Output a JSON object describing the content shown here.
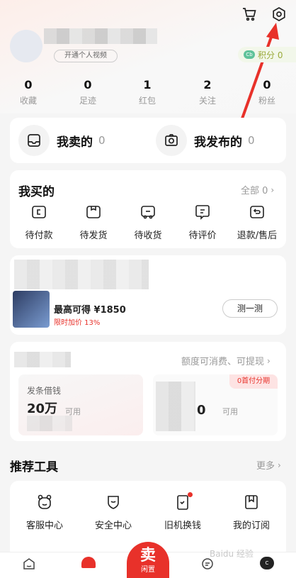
{
  "header": {
    "points_label": "积分 0",
    "points_badge": "Cb",
    "user_tag": "开通个人视频"
  },
  "stats": [
    {
      "value": "0",
      "label": "收藏"
    },
    {
      "value": "0",
      "label": "足迹"
    },
    {
      "value": "1",
      "label": "红包"
    },
    {
      "value": "2",
      "label": "关注"
    },
    {
      "value": "0",
      "label": "粉丝"
    }
  ],
  "sell": {
    "sold_label": "我卖的",
    "sold_count": "0",
    "posted_label": "我发布的",
    "posted_count": "0"
  },
  "orders": {
    "title": "我买的",
    "all_label": "全部 0",
    "items": [
      {
        "label": "待付款",
        "icon": "wallet-icon"
      },
      {
        "label": "待发货",
        "icon": "box-icon"
      },
      {
        "label": "待收货",
        "icon": "truck-icon"
      },
      {
        "label": "待评价",
        "icon": "comment-icon"
      },
      {
        "label": "退款/售后",
        "icon": "refund-icon"
      }
    ]
  },
  "recycle": {
    "price_label": "最高可得 ¥1850",
    "bonus_label": "限时加价 13%",
    "button_label": "测一测"
  },
  "loan": {
    "link_label": "额度可消费、可提现",
    "loan_label": "发条借钱",
    "amount": "20万",
    "available": "可用",
    "installment_badge": "0首付分期",
    "available2": "可用"
  },
  "tools": {
    "title": "推荐工具",
    "more_label": "更多",
    "items": [
      {
        "label": "客服中心",
        "icon": "bear-icon"
      },
      {
        "label": "安全中心",
        "icon": "shield-icon"
      },
      {
        "label": "旧机换钱",
        "icon": "phone-exchange-icon"
      },
      {
        "label": "我的订阅",
        "icon": "bookmark-icon"
      }
    ]
  },
  "tabbar": {
    "sell_top": "卖",
    "sell_bottom": "闲置",
    "items": [
      {
        "label": "首页"
      },
      {
        "label": "会玩"
      },
      {
        "label": "消息"
      },
      {
        "label": "我的"
      }
    ]
  },
  "watermark": "Baidu 经验"
}
